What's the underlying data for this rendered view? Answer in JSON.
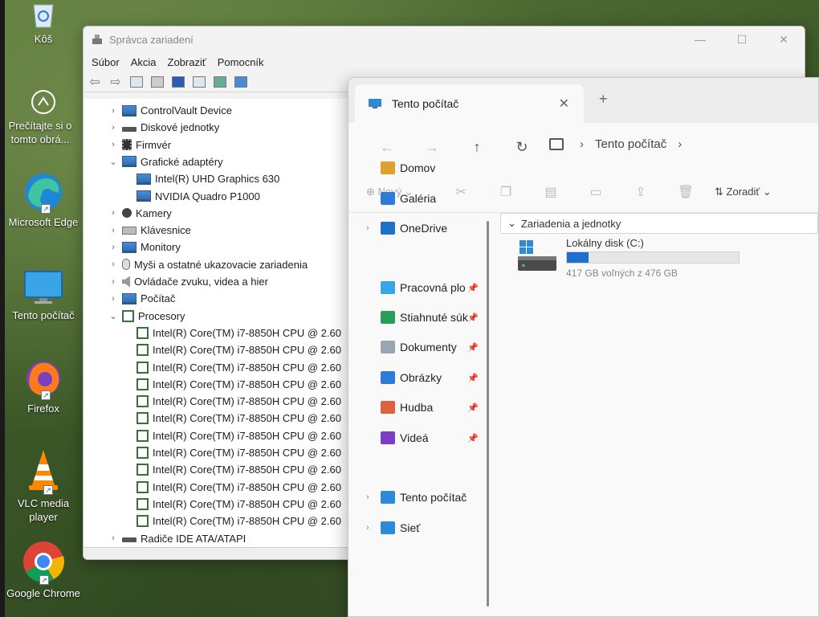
{
  "desktop": {
    "icons": [
      {
        "label": "Kôš",
        "icon": "recycle-bin-icon"
      },
      {
        "label": "Prečítajte si o tomto obrá...",
        "icon": "info-circle-icon"
      },
      {
        "label": "Microsoft Edge",
        "icon": "edge-icon"
      },
      {
        "label": "Tento počítač",
        "icon": "monitor-icon"
      },
      {
        "label": "Firefox",
        "icon": "firefox-icon"
      },
      {
        "label": "VLC media player",
        "icon": "vlc-cone-icon"
      },
      {
        "label": "Google Chrome",
        "icon": "chrome-icon"
      }
    ]
  },
  "device_manager": {
    "title": "Správca zariadení",
    "menu": [
      "Súbor",
      "Akcia",
      "Zobraziť",
      "Pomocník"
    ],
    "tree": [
      {
        "label": "ControlVault Device",
        "icon": "monitor",
        "chev": "›"
      },
      {
        "label": "Diskové jednotky",
        "icon": "drive",
        "chev": "›"
      },
      {
        "label": "Firmvér",
        "icon": "chip",
        "chev": "›"
      },
      {
        "label": "Grafické adaptéry",
        "icon": "monitor",
        "chev": "⌄"
      },
      {
        "label": "Intel(R) UHD Graphics 630",
        "icon": "monitor",
        "chev": ""
      },
      {
        "label": "NVIDIA Quadro P1000",
        "icon": "monitor",
        "chev": ""
      },
      {
        "label": "Kamery",
        "icon": "cam",
        "chev": "›"
      },
      {
        "label": "Klávesnice",
        "icon": "kbd",
        "chev": "›"
      },
      {
        "label": "Monitory",
        "icon": "monitor",
        "chev": "›"
      },
      {
        "label": "Myši a ostatné ukazovacie zariadenia",
        "icon": "mouse",
        "chev": "›"
      },
      {
        "label": "Ovládače zvuku, videa a hier",
        "icon": "sound",
        "chev": "›"
      },
      {
        "label": "Počítač",
        "icon": "monitor",
        "chev": "›"
      },
      {
        "label": "Procesory",
        "icon": "cpu",
        "chev": "⌄"
      },
      {
        "label": "Intel(R) Core(TM) i7-8850H CPU @ 2.60",
        "icon": "cpu",
        "chev": ""
      },
      {
        "label": "Intel(R) Core(TM) i7-8850H CPU @ 2.60",
        "icon": "cpu",
        "chev": ""
      },
      {
        "label": "Intel(R) Core(TM) i7-8850H CPU @ 2.60",
        "icon": "cpu",
        "chev": ""
      },
      {
        "label": "Intel(R) Core(TM) i7-8850H CPU @ 2.60",
        "icon": "cpu",
        "chev": ""
      },
      {
        "label": "Intel(R) Core(TM) i7-8850H CPU @ 2.60",
        "icon": "cpu",
        "chev": ""
      },
      {
        "label": "Intel(R) Core(TM) i7-8850H CPU @ 2.60",
        "icon": "cpu",
        "chev": ""
      },
      {
        "label": "Intel(R) Core(TM) i7-8850H CPU @ 2.60",
        "icon": "cpu",
        "chev": ""
      },
      {
        "label": "Intel(R) Core(TM) i7-8850H CPU @ 2.60",
        "icon": "cpu",
        "chev": ""
      },
      {
        "label": "Intel(R) Core(TM) i7-8850H CPU @ 2.60",
        "icon": "cpu",
        "chev": ""
      },
      {
        "label": "Intel(R) Core(TM) i7-8850H CPU @ 2.60",
        "icon": "cpu",
        "chev": ""
      },
      {
        "label": "Intel(R) Core(TM) i7-8850H CPU @ 2.60",
        "icon": "cpu",
        "chev": ""
      },
      {
        "label": "Intel(R) Core(TM) i7-8850H CPU @ 2.60",
        "icon": "cpu",
        "chev": ""
      },
      {
        "label": "Radiče IDE ATA/ATAPI",
        "icon": "drive",
        "chev": "›"
      }
    ]
  },
  "explorer": {
    "tab_title": "Tento počítač",
    "breadcrumb": [
      "Tento počítač"
    ],
    "commands": {
      "new": "Nový",
      "sort": "Zoradiť"
    },
    "sidebar": [
      {
        "label": "Domov",
        "icon": "home-icon",
        "pinned": false,
        "chev": false
      },
      {
        "label": "Galéria",
        "icon": "gallery-icon",
        "pinned": false,
        "chev": false
      },
      {
        "label": "OneDrive",
        "icon": "cloud-icon",
        "pinned": false,
        "chev": true
      },
      {
        "label": "Pracovná plo",
        "icon": "desktop-icon",
        "pinned": true,
        "chev": false
      },
      {
        "label": "Stiahnuté súk",
        "icon": "download-icon",
        "pinned": true,
        "chev": false
      },
      {
        "label": "Dokumenty",
        "icon": "document-icon",
        "pinned": true,
        "chev": false
      },
      {
        "label": "Obrázky",
        "icon": "pictures-icon",
        "pinned": true,
        "chev": false
      },
      {
        "label": "Hudba",
        "icon": "music-icon",
        "pinned": true,
        "chev": false
      },
      {
        "label": "Videá",
        "icon": "video-icon",
        "pinned": true,
        "chev": false
      },
      {
        "label": "Tento počítač",
        "icon": "monitor-icon",
        "pinned": false,
        "chev": true
      },
      {
        "label": "Sieť",
        "icon": "network-icon",
        "pinned": false,
        "chev": true
      }
    ],
    "group_header": "Zariadenia a jednotky",
    "drive": {
      "name": "Lokálny disk (C:)",
      "free_text": "417 GB voľných z 476 GB",
      "used_fraction": 0.124
    }
  }
}
